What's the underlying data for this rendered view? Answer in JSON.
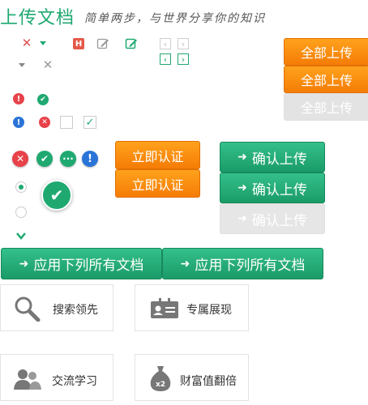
{
  "header": {
    "title": "上传文档",
    "subtitle": "简单两步，与世界分享你的知识"
  },
  "orange_buttons": {
    "upload_all_1": "全部上传",
    "upload_all_2": "全部上传",
    "upload_all_disabled": "全部上传",
    "verify_1": "立即认证",
    "verify_2": "立即认证"
  },
  "green_buttons": {
    "confirm_1": "确认上传",
    "confirm_2": "确认上传",
    "confirm_disabled": "确认上传",
    "apply_1": "应用下列所有文档",
    "apply_2": "应用下列所有文档"
  },
  "nav_arrows": {
    "prev": "‹",
    "next": "›"
  },
  "cards": [
    {
      "label": "搜索领先",
      "icon": "search-icon"
    },
    {
      "label": "专属展现",
      "icon": "id-card-icon"
    },
    {
      "label": "交流学习",
      "icon": "users-icon"
    },
    {
      "label": "财富值翻倍",
      "icon": "money-bag-icon"
    }
  ],
  "colors": {
    "brand_green": "#1fa971",
    "orange": "#f58a0b",
    "error_red": "#e8424a",
    "info_blue": "#2a74d8"
  }
}
